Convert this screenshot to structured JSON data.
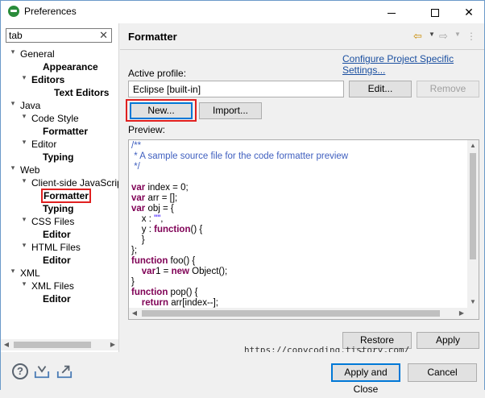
{
  "window": {
    "title": "Preferences"
  },
  "filter": {
    "value": "tab"
  },
  "tree": [
    {
      "label": "General",
      "bold": false,
      "indent": 0,
      "twisty": "▾"
    },
    {
      "label": "Appearance",
      "bold": true,
      "indent": 2,
      "twisty": ""
    },
    {
      "label": "Editors",
      "bold": true,
      "indent": 1,
      "twisty": "▾"
    },
    {
      "label": "Text Editors",
      "bold": true,
      "indent": 3,
      "twisty": ""
    },
    {
      "label": "Java",
      "bold": false,
      "indent": 0,
      "twisty": "▾"
    },
    {
      "label": "Code Style",
      "bold": false,
      "indent": 1,
      "twisty": "▾"
    },
    {
      "label": "Formatter",
      "bold": true,
      "indent": 2,
      "twisty": ""
    },
    {
      "label": "Editor",
      "bold": false,
      "indent": 1,
      "twisty": "▾"
    },
    {
      "label": "Typing",
      "bold": true,
      "indent": 2,
      "twisty": ""
    },
    {
      "label": "Web",
      "bold": false,
      "indent": 0,
      "twisty": "▾"
    },
    {
      "label": "Client-side JavaScrip",
      "bold": false,
      "indent": 1,
      "twisty": "▾"
    },
    {
      "label": "Formatter",
      "bold": true,
      "indent": 2,
      "twisty": "",
      "highlight": true
    },
    {
      "label": "Typing",
      "bold": true,
      "indent": 2,
      "twisty": ""
    },
    {
      "label": "CSS Files",
      "bold": false,
      "indent": 1,
      "twisty": "▾"
    },
    {
      "label": "Editor",
      "bold": true,
      "indent": 2,
      "twisty": ""
    },
    {
      "label": "HTML Files",
      "bold": false,
      "indent": 1,
      "twisty": "▾"
    },
    {
      "label": "Editor",
      "bold": true,
      "indent": 2,
      "twisty": ""
    },
    {
      "label": "XML",
      "bold": false,
      "indent": 0,
      "twisty": "▾"
    },
    {
      "label": "XML Files",
      "bold": false,
      "indent": 1,
      "twisty": "▾"
    },
    {
      "label": "Editor",
      "bold": true,
      "indent": 2,
      "twisty": ""
    }
  ],
  "page": {
    "title": "Formatter",
    "configure_link": "Configure Project Specific Settings...",
    "active_profile_label": "Active profile:",
    "profile_value": "Eclipse [built-in]",
    "edit_label": "Edit...",
    "remove_label": "Remove",
    "new_label": "New...",
    "import_label": "Import...",
    "preview_label": "Preview:"
  },
  "preview_code": [
    [
      [
        "c-com",
        "/**"
      ]
    ],
    [
      [
        "c-com",
        " * A sample source file for the code formatter preview"
      ]
    ],
    [
      [
        "c-com",
        " */"
      ]
    ],
    [
      [
        "",
        ""
      ]
    ],
    [
      [
        "c-kw",
        "var"
      ],
      [
        "",
        " index = 0;"
      ]
    ],
    [
      [
        "c-kw",
        "var"
      ],
      [
        "",
        " arr = [];"
      ]
    ],
    [
      [
        "c-kw",
        "var"
      ],
      [
        "",
        " obj = {"
      ]
    ],
    [
      [
        "",
        "    x : "
      ],
      [
        "c-str",
        "\"\""
      ],
      [
        "",
        ","
      ]
    ],
    [
      [
        "",
        "    y : "
      ],
      [
        "c-kw",
        "function"
      ],
      [
        "",
        "() {"
      ]
    ],
    [
      [
        "",
        "    }"
      ]
    ],
    [
      [
        "",
        "};"
      ]
    ],
    [
      [
        "c-kw",
        "function"
      ],
      [
        "",
        " foo() {"
      ]
    ],
    [
      [
        "",
        "    "
      ],
      [
        "c-kw",
        "var"
      ],
      [
        "",
        "1 = "
      ],
      [
        "c-kw",
        "new"
      ],
      [
        "",
        " Object();"
      ]
    ],
    [
      [
        "",
        "}"
      ]
    ],
    [
      [
        "c-kw",
        "function"
      ],
      [
        "",
        " pop() {"
      ]
    ],
    [
      [
        "",
        "    "
      ],
      [
        "c-kw",
        "return"
      ],
      [
        "",
        " arr[index--];"
      ]
    ],
    [
      [
        "",
        "}"
      ]
    ]
  ],
  "buttons": {
    "restore_defaults": "Restore Defaults",
    "apply": "Apply",
    "apply_and_close": "Apply and Close",
    "cancel": "Cancel"
  },
  "watermark": "https://copycoding.tistory.com/",
  "colors": {
    "highlight_red": "#e02020",
    "link_blue": "#1a4fa0",
    "keyword": "#7f0055",
    "comment": "#3f5fbf",
    "string": "#2a00ff"
  }
}
